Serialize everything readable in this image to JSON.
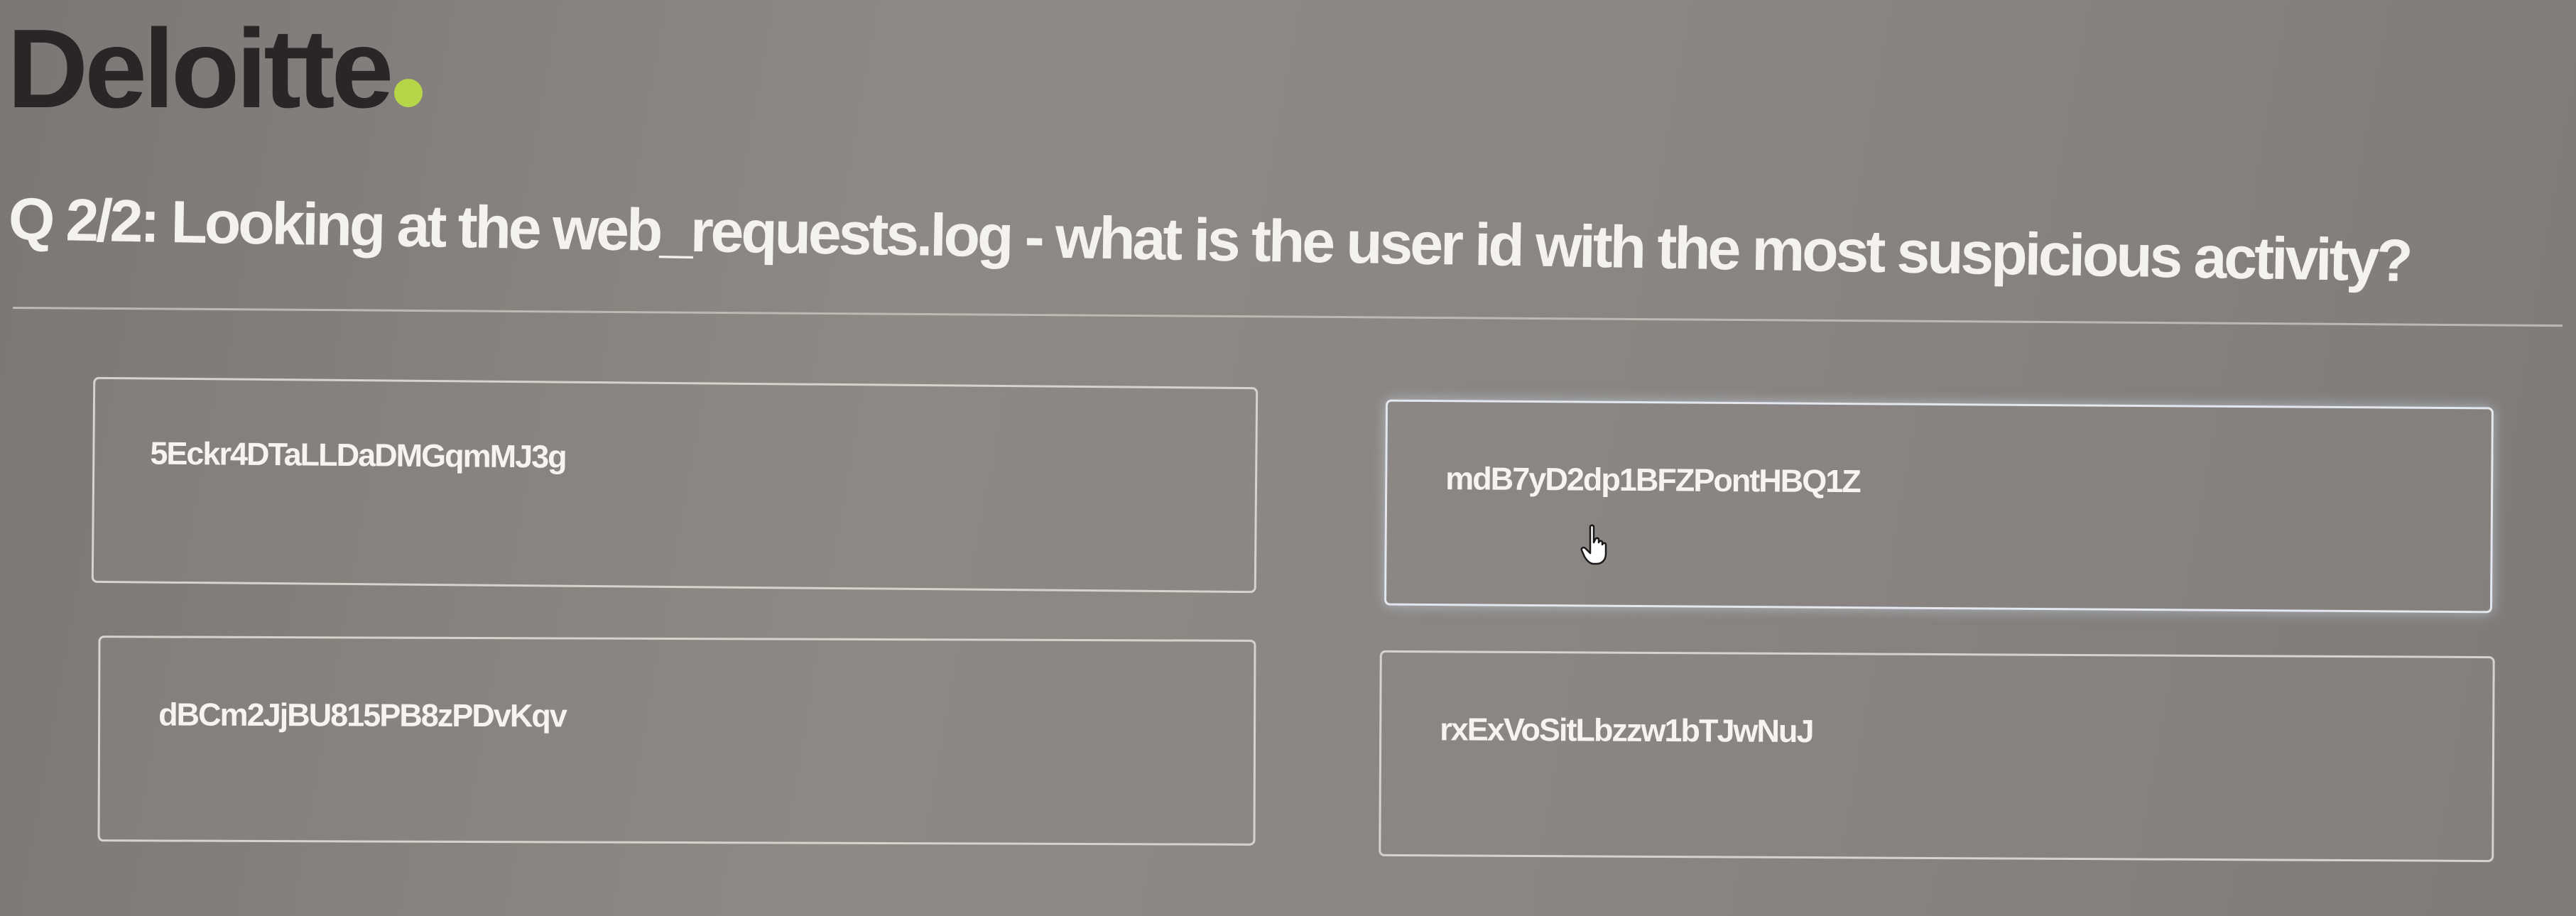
{
  "logo": {
    "text": "Deloitte",
    "dot_color": "#b6d64a",
    "icon": "deloitte-logo"
  },
  "question": {
    "text": "Q 2/2: Looking at the web_requests.log - what is the user id with the most suspicious activity?"
  },
  "options": [
    {
      "label": "5Eckr4DTaLLDaDMGqmMJ3g"
    },
    {
      "label": "mdB7yD2dp1BFZPontHBQ1Z",
      "state": "hovered"
    },
    {
      "label": "dBCm2JjBU815PB8zPDvKqv"
    },
    {
      "label": "rxExVoSitLbzzw1bTJwNuJ"
    }
  ],
  "cursor": {
    "icon": "hand-pointer-icon"
  }
}
